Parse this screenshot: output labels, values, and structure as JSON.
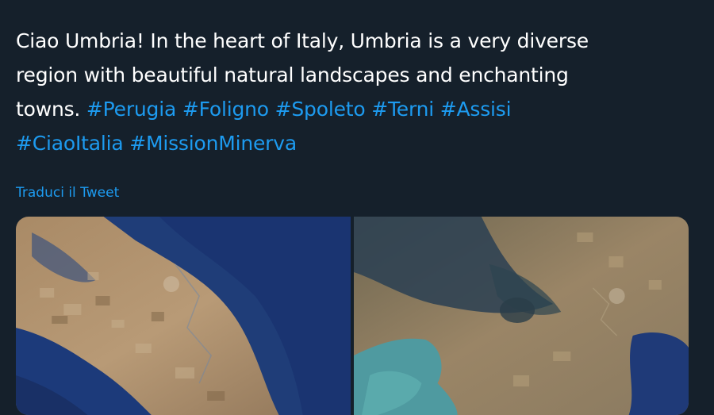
{
  "tweet": {
    "lines": [
      [
        {
          "text": "Ciao Umbria! In the heart of Italy, Umbria is a very diverse"
        }
      ],
      [
        {
          "text": "region with beautiful natural landscapes and enchanting"
        }
      ],
      [
        {
          "text": "towns. "
        },
        {
          "text": "#Perugia",
          "hashtag": true
        },
        {
          "text": " "
        },
        {
          "text": "#Foligno",
          "hashtag": true
        },
        {
          "text": " "
        },
        {
          "text": "#Spoleto",
          "hashtag": true
        },
        {
          "text": " "
        },
        {
          "text": "#Terni",
          "hashtag": true
        },
        {
          "text": " "
        },
        {
          "text": "#Assisi",
          "hashtag": true
        }
      ],
      [
        {
          "text": "#CiaoItalia",
          "hashtag": true
        },
        {
          "text": " "
        },
        {
          "text": "#MissionMinerva",
          "hashtag": true
        }
      ]
    ],
    "translate_label": "Traduci il Tweet"
  },
  "media": [
    {
      "name": "satellite-photo-1"
    },
    {
      "name": "satellite-photo-2"
    }
  ],
  "colors": {
    "background": "#15202b",
    "text": "#ffffff",
    "link": "#1d9bf0"
  }
}
